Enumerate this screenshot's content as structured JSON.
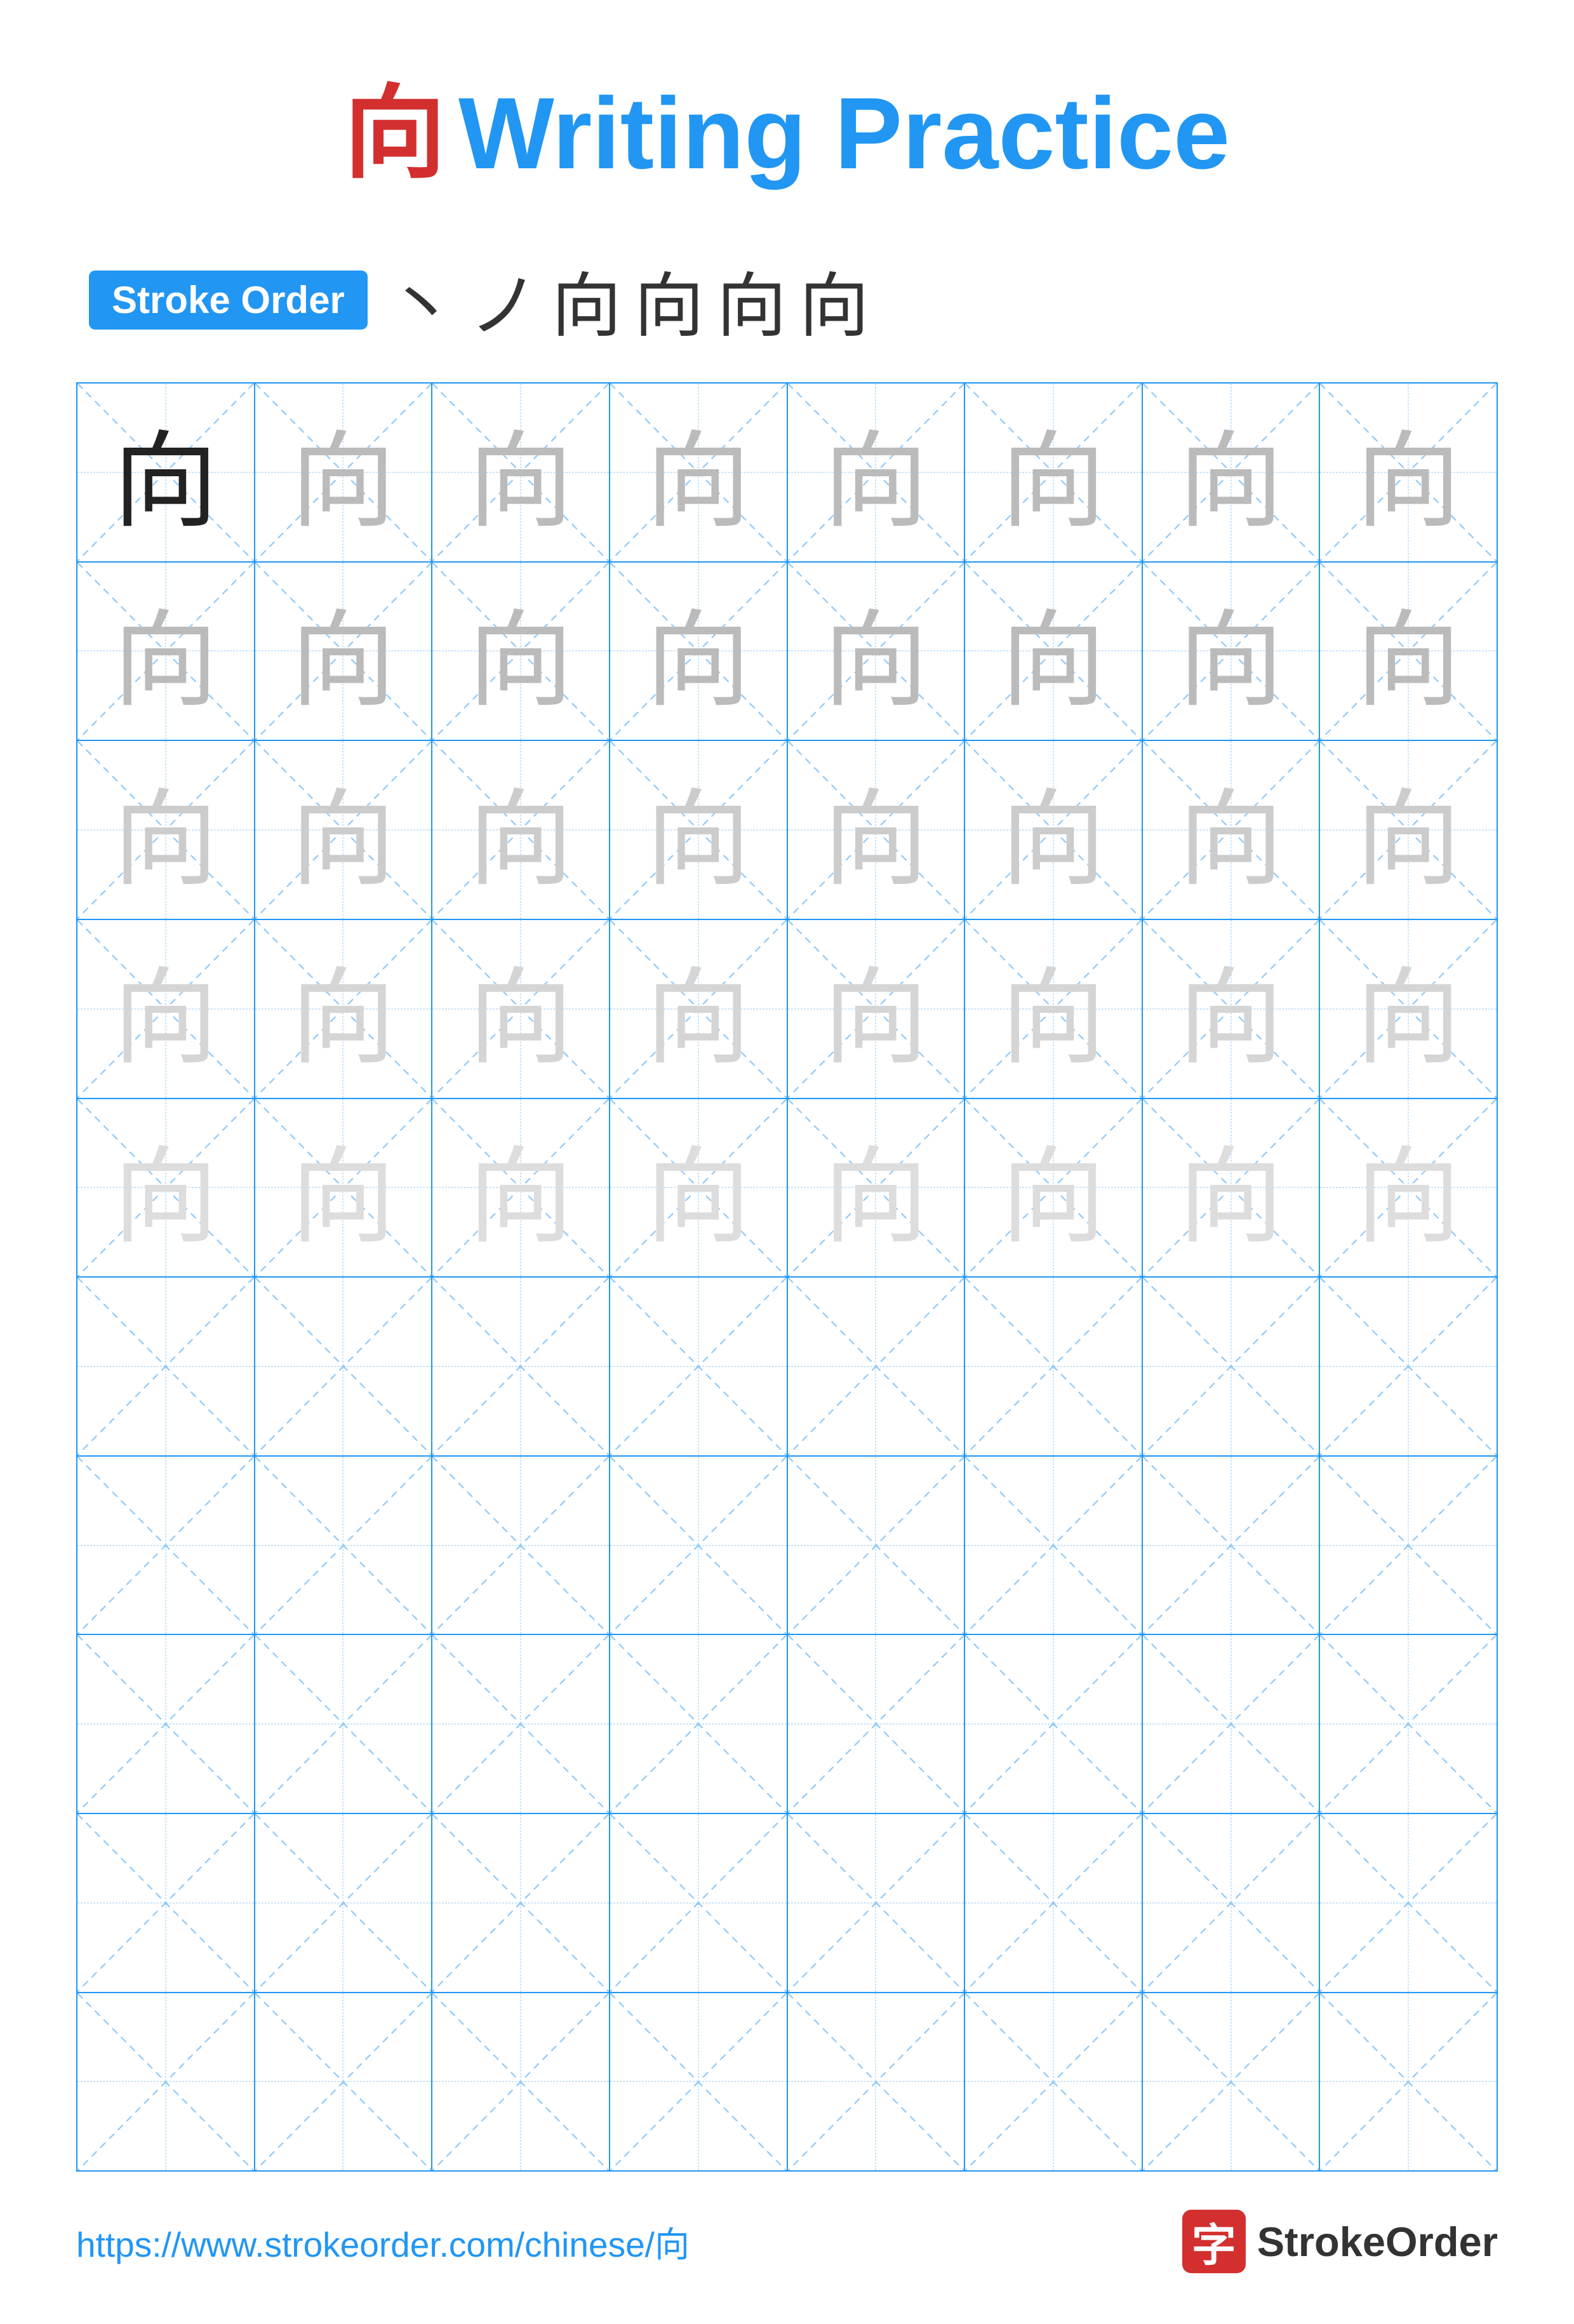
{
  "title": {
    "character": "向",
    "label": "Writing Practice",
    "accent_color": "#2196F3",
    "char_color": "#d32f2f"
  },
  "stroke_order": {
    "badge_label": "Stroke Order",
    "sequence": [
      "丶",
      "ノ",
      "向",
      "向",
      "向",
      "向"
    ]
  },
  "grid": {
    "cols": 8,
    "character": "向",
    "rows_with_chars": 5,
    "total_rows": 10,
    "row_data": [
      [
        "dark",
        "light-1",
        "light-1",
        "light-1",
        "light-1",
        "light-1",
        "light-1",
        "light-1"
      ],
      [
        "light-1",
        "light-1",
        "light-1",
        "light-1",
        "light-1",
        "light-1",
        "light-1",
        "light-1"
      ],
      [
        "light-2",
        "light-2",
        "light-2",
        "light-2",
        "light-2",
        "light-2",
        "light-2",
        "light-2"
      ],
      [
        "light-3",
        "light-3",
        "light-3",
        "light-3",
        "light-3",
        "light-3",
        "light-3",
        "light-3"
      ],
      [
        "light-4",
        "light-4",
        "light-4",
        "light-4",
        "light-4",
        "light-4",
        "light-4",
        "light-4"
      ],
      [
        "empty",
        "empty",
        "empty",
        "empty",
        "empty",
        "empty",
        "empty",
        "empty"
      ],
      [
        "empty",
        "empty",
        "empty",
        "empty",
        "empty",
        "empty",
        "empty",
        "empty"
      ],
      [
        "empty",
        "empty",
        "empty",
        "empty",
        "empty",
        "empty",
        "empty",
        "empty"
      ],
      [
        "empty",
        "empty",
        "empty",
        "empty",
        "empty",
        "empty",
        "empty",
        "empty"
      ],
      [
        "empty",
        "empty",
        "empty",
        "empty",
        "empty",
        "empty",
        "empty",
        "empty"
      ]
    ]
  },
  "footer": {
    "url": "https://www.strokeorder.com/chinese/向",
    "logo_char": "字",
    "logo_text": "StrokeOrder"
  }
}
